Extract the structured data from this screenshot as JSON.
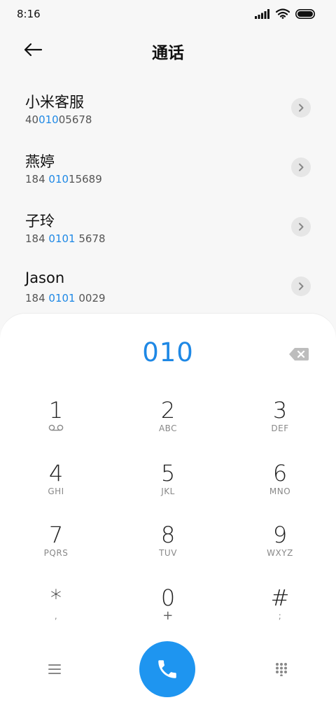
{
  "status_bar": {
    "time": "8:16",
    "icons": [
      "signal-icon",
      "wifi-icon",
      "battery-icon"
    ]
  },
  "header": {
    "title": "通话",
    "back_icon": "arrow-left-icon"
  },
  "contacts": [
    {
      "name": "小米客服",
      "number_pre": "40",
      "number_match": "010",
      "number_post": "05678"
    },
    {
      "name": "燕婷",
      "number_pre": "184 ",
      "number_match": "010",
      "number_post": "15689"
    },
    {
      "name": "子玲",
      "number_pre": "184 ",
      "number_match": "0101",
      "number_post": " 5678"
    },
    {
      "name": "Jason",
      "number_pre": "184 ",
      "number_match": "0101",
      "number_post": " 0029"
    }
  ],
  "dialpad": {
    "entered_number": "010",
    "keys": [
      {
        "digit": "1",
        "sub": "voicemail-icon"
      },
      {
        "digit": "2",
        "sub": "ABC"
      },
      {
        "digit": "3",
        "sub": "DEF"
      },
      {
        "digit": "4",
        "sub": "GHI"
      },
      {
        "digit": "5",
        "sub": "JKL"
      },
      {
        "digit": "6",
        "sub": "MNO"
      },
      {
        "digit": "7",
        "sub": "PQRS"
      },
      {
        "digit": "8",
        "sub": "TUV"
      },
      {
        "digit": "9",
        "sub": "WXYZ"
      },
      {
        "digit": "*",
        "sub": ","
      },
      {
        "digit": "0",
        "sub": "+"
      },
      {
        "digit": "#",
        "sub": ";"
      }
    ]
  },
  "colors": {
    "accent": "#1e88e5",
    "call_button": "#1e95f0",
    "background": "#f7f7f7"
  }
}
